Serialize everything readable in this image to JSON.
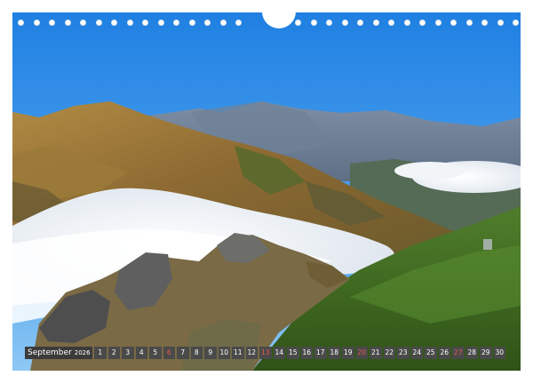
{
  "calendar": {
    "month_label": "September",
    "year_label": "2026",
    "days": [
      "1",
      "2",
      "3",
      "4",
      "5",
      "6",
      "7",
      "8",
      "9",
      "10",
      "11",
      "12",
      "13",
      "14",
      "15",
      "16",
      "17",
      "18",
      "19",
      "20",
      "21",
      "22",
      "23",
      "24",
      "25",
      "26",
      "27",
      "28",
      "29",
      "30"
    ],
    "sundays": [
      "6",
      "13",
      "20",
      "27"
    ]
  },
  "colors": {
    "sky_top": "#1e7fe0",
    "sky_bottom": "#7cc0f3",
    "mountain_gold": "#b48a3a",
    "cloud": "#f4f4f4",
    "grass": "#3f6b22",
    "sunday_text": "#e8584f",
    "calendar_cell": "#4a4a4a"
  }
}
